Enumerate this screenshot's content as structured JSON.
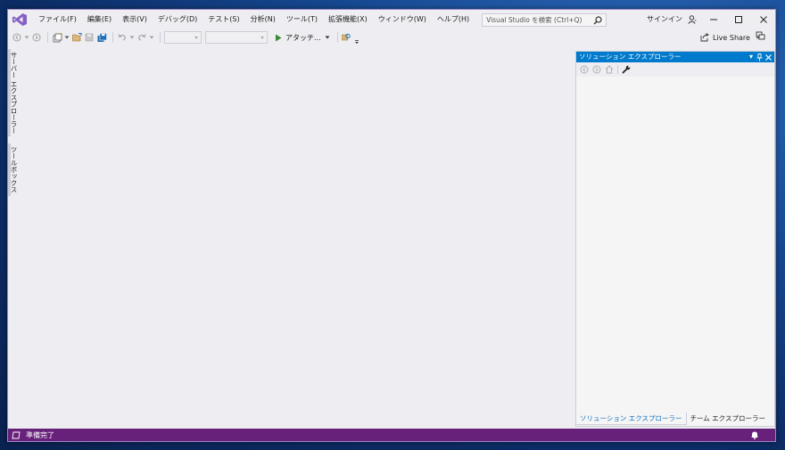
{
  "menu": {
    "items": [
      "ファイル(F)",
      "編集(E)",
      "表示(V)",
      "デバッグ(D)",
      "テスト(S)",
      "分析(N)",
      "ツール(T)",
      "拡張機能(X)",
      "ウィンドウ(W)",
      "ヘルプ(H)"
    ]
  },
  "search": {
    "placeholder": "Visual Studio を検索 (Ctrl+Q)"
  },
  "account": {
    "signin_label": "サインイン"
  },
  "toolbar": {
    "attach_label": "アタッチ...",
    "liveshare_label": "Live Share"
  },
  "left_tabs": [
    "サーバー エクスプローラー",
    "ツールボックス"
  ],
  "solution_explorer": {
    "title": "ソリューション エクスプローラー",
    "tabs": [
      "ソリューション エクスプローラー",
      "チーム エクスプローラー"
    ]
  },
  "status": {
    "text": "準備完了"
  },
  "colors": {
    "accent": "#007acc",
    "statusbar": "#68217a",
    "vs_logo": "#865fc5"
  }
}
